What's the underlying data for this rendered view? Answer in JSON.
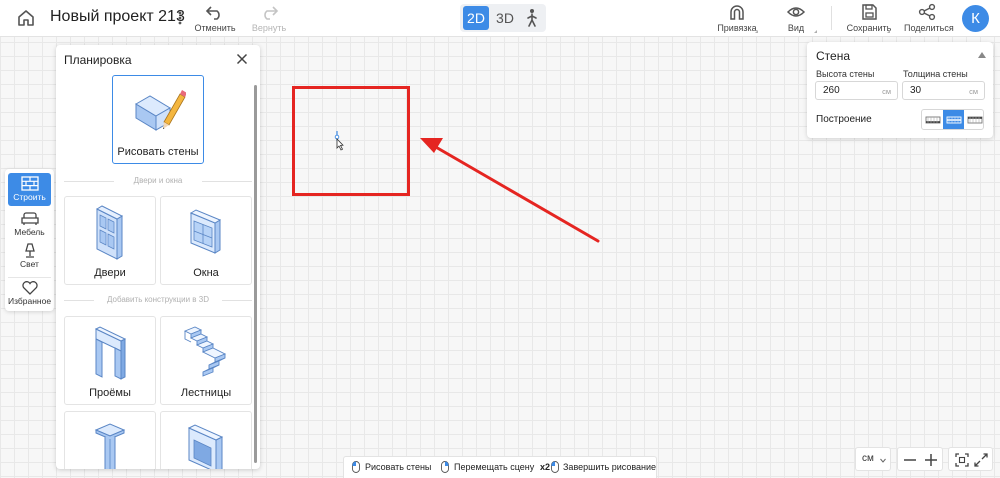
{
  "header": {
    "project_title": "Новый проект 213",
    "undo_label": "Отменить",
    "redo_label": "Вернуть",
    "view_modes": [
      "2D",
      "3D"
    ],
    "active_view": "2D",
    "snap_label": "Привязка",
    "view_label": "Вид",
    "save_label": "Сохранить",
    "share_label": "Поделиться",
    "avatar_letter": "К"
  },
  "sidebar": {
    "items": [
      {
        "label": "Строить",
        "icon": "brick-wall-icon",
        "active": true
      },
      {
        "label": "Мебель",
        "icon": "sofa-icon",
        "active": false
      },
      {
        "label": "Свет",
        "icon": "lamp-icon",
        "active": false
      },
      {
        "label": "Избранное",
        "icon": "heart-icon",
        "active": false
      }
    ]
  },
  "planning_panel": {
    "title": "Планировка",
    "draw_walls_label": "Рисовать стены",
    "section_doors_windows": "Двери и окна",
    "doors_label": "Двери",
    "windows_label": "Окна",
    "section_3d": "Добавить конструкции в 3D",
    "openings_label": "Проёмы",
    "stairs_label": "Лестницы"
  },
  "wall_panel": {
    "title": "Стена",
    "height_label": "Высота стены",
    "height_value": "260",
    "thickness_label": "Толщина стены",
    "thickness_value": "30",
    "unit": "см",
    "build_label": "Построение",
    "build_modes": [
      "inner-line",
      "center-line",
      "outer-line"
    ],
    "active_build_mode": "center-line"
  },
  "hints": {
    "draw_walls": "Рисовать стены",
    "move_scene": "Перемещать сцену",
    "finish_prefix": "x2",
    "finish_drawing": "Завершить рисование"
  },
  "controls": {
    "unit_value": "см"
  },
  "colors": {
    "accent": "#3d8be6",
    "annotation_red": "#e52521"
  }
}
